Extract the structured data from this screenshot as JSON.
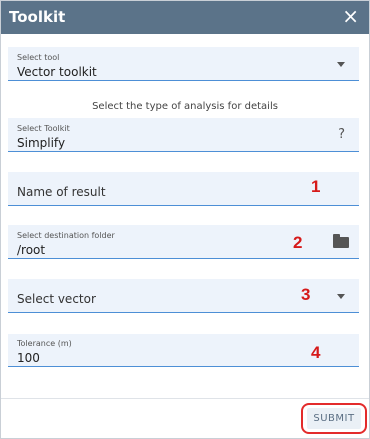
{
  "dialog": {
    "title": "Toolkit",
    "close_glyph": "×"
  },
  "tool_select": {
    "label": "Select tool",
    "value": "Vector toolkit",
    "icon": "chevron-down-icon"
  },
  "hint_text": "Select the type of analysis for details",
  "toolkit_select": {
    "label": "Select Toolkit",
    "value": "Simplify",
    "help_glyph": "?"
  },
  "result_name": {
    "placeholder": "Name of result",
    "annotation": "1"
  },
  "destination": {
    "label": "Select destination folder",
    "value": "/root",
    "icon": "folder-icon",
    "annotation": "2"
  },
  "vector_select": {
    "placeholder": "Select vector",
    "icon": "chevron-down-icon",
    "annotation": "3"
  },
  "tolerance": {
    "label": "Tolerance (m)",
    "value": "100",
    "annotation": "4"
  },
  "footer": {
    "submit_label": "SUBMIT"
  },
  "colors": {
    "header_bg": "#5b7389",
    "field_bg": "#edf3fb",
    "underline": "#4d8fd6",
    "annotation_red": "#d61a1a"
  }
}
